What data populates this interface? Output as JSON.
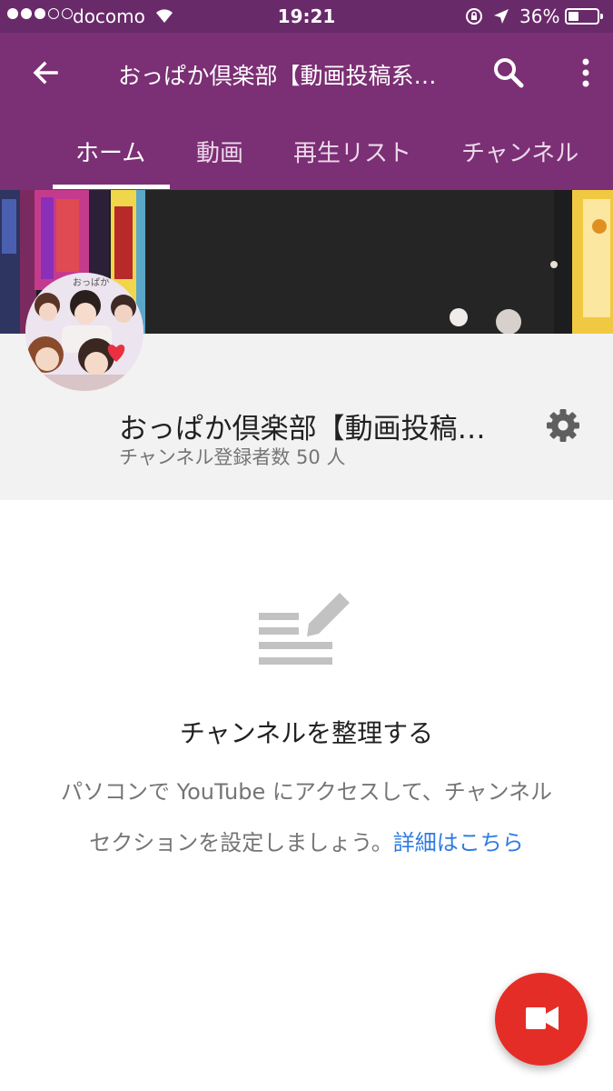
{
  "status_bar": {
    "carrier": "docomo",
    "time": "19:21",
    "battery": "36%",
    "battery_level": 0.36
  },
  "app_bar": {
    "title": "おっぱか倶楽部【動画投稿系…",
    "back_icon": "arrow-left-icon",
    "search_icon": "search-icon",
    "more_icon": "more-vert-icon"
  },
  "tabs": [
    {
      "label": "ホーム",
      "selected": true
    },
    {
      "label": "動画",
      "selected": false
    },
    {
      "label": "再生リスト",
      "selected": false
    },
    {
      "label": "チャンネル",
      "selected": false
    }
  ],
  "channel": {
    "name": "おっぱか倶楽部【動画投稿…",
    "subscribers": "チャンネル登録者数 50 人",
    "avatar_text": "おっぱか"
  },
  "empty_state": {
    "icon": "edit-list-icon",
    "heading": "チャンネルを整理する",
    "description_line1": "パソコンで YouTube にアクセスして、チャンネル",
    "description_line2": "セクションを設定しましょう。",
    "link": "詳細はこちら"
  },
  "fab": {
    "icon": "video-camera-icon"
  },
  "colors": {
    "status_bar": "#692a6a",
    "app_bar": "#7b2f74",
    "fab": "#e52d27",
    "link": "#2f7be0"
  }
}
